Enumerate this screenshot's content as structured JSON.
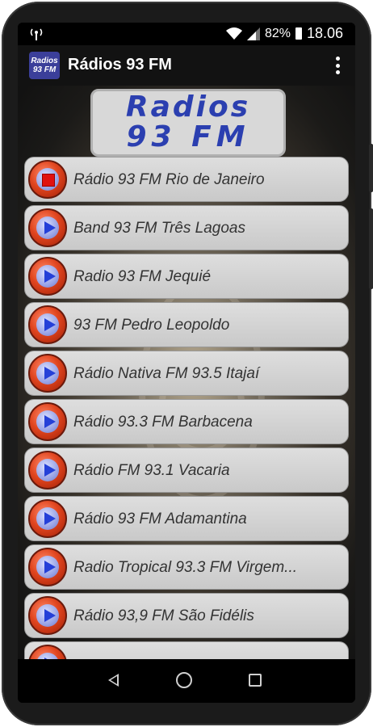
{
  "status_bar": {
    "time": "18.06",
    "battery": "82%",
    "icons": [
      "broadcast-icon",
      "wifi-icon",
      "signal-icon",
      "battery-icon"
    ]
  },
  "app_bar": {
    "logo_line1": "Radios",
    "logo_line2": "93 FM",
    "title": "Rádios 93 FM",
    "menu_icon": "more-vert-icon"
  },
  "banner": {
    "line1": "Radios",
    "line2": "93 FM"
  },
  "stations": [
    {
      "name": "Rádio 93 FM Rio de Janeiro",
      "state": "playing"
    },
    {
      "name": "Band 93 FM Três Lagoas",
      "state": "stopped"
    },
    {
      "name": "Radio 93 FM Jequié",
      "state": "stopped"
    },
    {
      "name": "93 FM Pedro Leopoldo",
      "state": "stopped"
    },
    {
      "name": "Rádio Nativa FM 93.5 Itajaí",
      "state": "stopped"
    },
    {
      "name": "Rádio 93.3 FM Barbacena",
      "state": "stopped"
    },
    {
      "name": "Rádio FM 93.1 Vacaria",
      "state": "stopped"
    },
    {
      "name": "Rádio 93 FM Adamantina",
      "state": "stopped"
    },
    {
      "name": "Radio Tropical 93.3 FM Virgem...",
      "state": "stopped"
    },
    {
      "name": "Rádio 93,9 FM São Fidélis",
      "state": "stopped"
    },
    {
      "name": "",
      "state": "stopped"
    }
  ],
  "nav_bar": {
    "icons": [
      "back-icon",
      "home-icon",
      "recents-icon"
    ]
  },
  "colors": {
    "banner_text": "#2b3fb0",
    "play_outer": "#e0451f",
    "play_triangle": "#2540d8",
    "stop_square": "#e01010",
    "item_bg": "#d4d4d4"
  }
}
